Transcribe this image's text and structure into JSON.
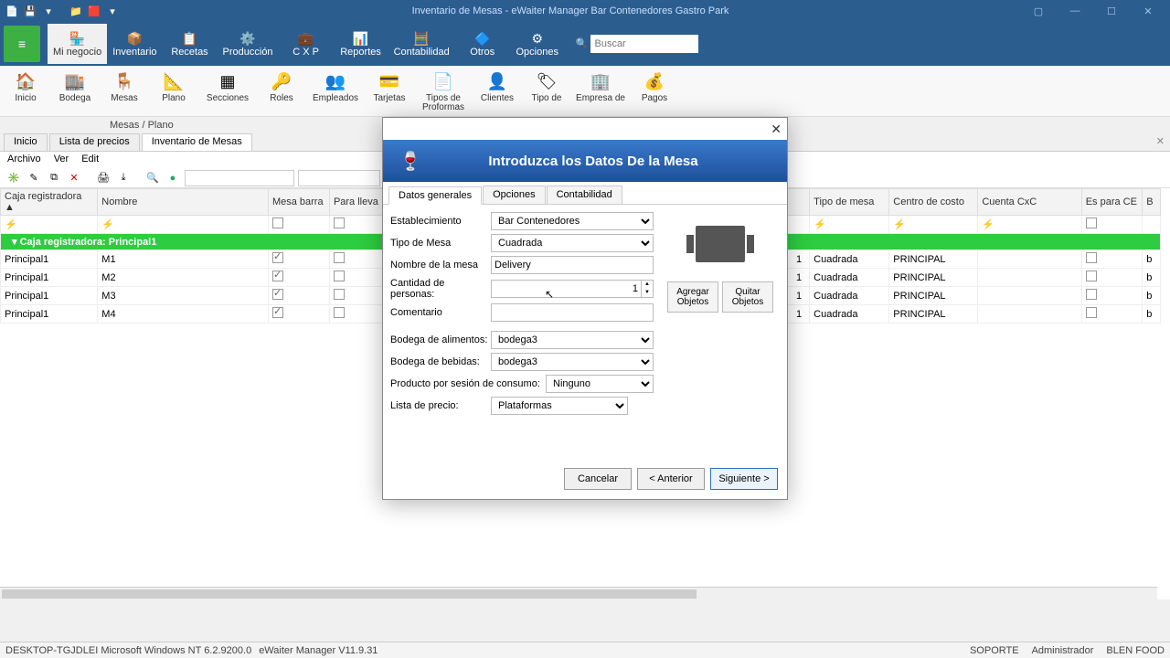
{
  "title": "Inventario de Mesas - eWaiter Manager Bar Contenedores Gastro Park",
  "ribbon": {
    "tabs": [
      "Mi negocio",
      "Inventario",
      "Recetas",
      "Producción",
      "C X P",
      "Reportes",
      "Contabilidad",
      "Otros",
      "Opciones"
    ],
    "active": 0,
    "search_placeholder": "Buscar"
  },
  "subbar": [
    "Inicio",
    "Bodega",
    "Mesas",
    "Plano",
    "Secciones",
    "Roles",
    "Empleados",
    "Tarjetas",
    "Tipos de Proformas",
    "Clientes",
    "Tipo de",
    "Empresa de",
    "Pagos"
  ],
  "breadcrumb": "Mesas / Plano",
  "doctabs": {
    "items": [
      "Inicio",
      "Lista de precios",
      "Inventario de Mesas"
    ],
    "active": 2
  },
  "menubar": [
    "Archivo",
    "Ver",
    "Edit"
  ],
  "grid": {
    "headers": [
      "Caja registradora ▲",
      "Nombre",
      "Mesa barra",
      "Para lleva",
      "",
      "",
      "Tipo de mesa",
      "Centro de costo",
      "Cuenta CxC",
      "Es para CE",
      "B"
    ],
    "group": "Caja registradora: Principal1",
    "rows": [
      {
        "caja": "Principal1",
        "nombre": "M1",
        "barra": true,
        "lleva": false,
        "n": "1",
        "tipo": "Cuadrada",
        "centro": "PRINCIPAL",
        "cxc": "",
        "ce": false,
        "b": "b"
      },
      {
        "caja": "Principal1",
        "nombre": "M2",
        "barra": true,
        "lleva": false,
        "n": "1",
        "tipo": "Cuadrada",
        "centro": "PRINCIPAL",
        "cxc": "",
        "ce": false,
        "b": "b"
      },
      {
        "caja": "Principal1",
        "nombre": "M3",
        "barra": true,
        "lleva": false,
        "n": "1",
        "tipo": "Cuadrada",
        "centro": "PRINCIPAL",
        "cxc": "",
        "ce": false,
        "b": "b"
      },
      {
        "caja": "Principal1",
        "nombre": "M4",
        "barra": true,
        "lleva": false,
        "n": "1",
        "tipo": "Cuadrada",
        "centro": "PRINCIPAL",
        "cxc": "",
        "ce": false,
        "b": "b"
      }
    ]
  },
  "dialog": {
    "title": "Introduzca los Datos De la Mesa",
    "tabs": [
      "Datos generales",
      "Opciones",
      "Contabilidad"
    ],
    "active": 0,
    "labels": {
      "establecimiento": "Establecimiento",
      "tipo": "Tipo de Mesa",
      "nombre": "Nombre de la mesa",
      "cantidad": "Cantidad de personas:",
      "comentario": "Comentario",
      "bodegaA": "Bodega de alimentos:",
      "bodegaB": "Bodega de bebidas:",
      "producto": "Producto por sesión de consumo:",
      "lista": "Lista de precio:"
    },
    "values": {
      "establecimiento": "Bar Contenedores",
      "tipo": "Cuadrada",
      "nombre": "Delivery",
      "cantidad": "1",
      "comentario": "",
      "bodegaA": "bodega3",
      "bodegaB": "bodega3",
      "producto": "Ninguno",
      "lista": "Plataformas"
    },
    "side": {
      "agregar": "Agregar Objetos",
      "quitar": "Quitar Objetos"
    },
    "buttons": {
      "cancel": "Cancelar",
      "prev": "< Anterior",
      "next": "Siguiente >"
    }
  },
  "status": {
    "left1": "DESKTOP-TGJDLEI Microsoft Windows NT 6.2.9200.0",
    "left2": "eWaiter Manager V11.9.31",
    "right": [
      "SOPORTE",
      "Administrador",
      "BLEN FOOD"
    ]
  }
}
